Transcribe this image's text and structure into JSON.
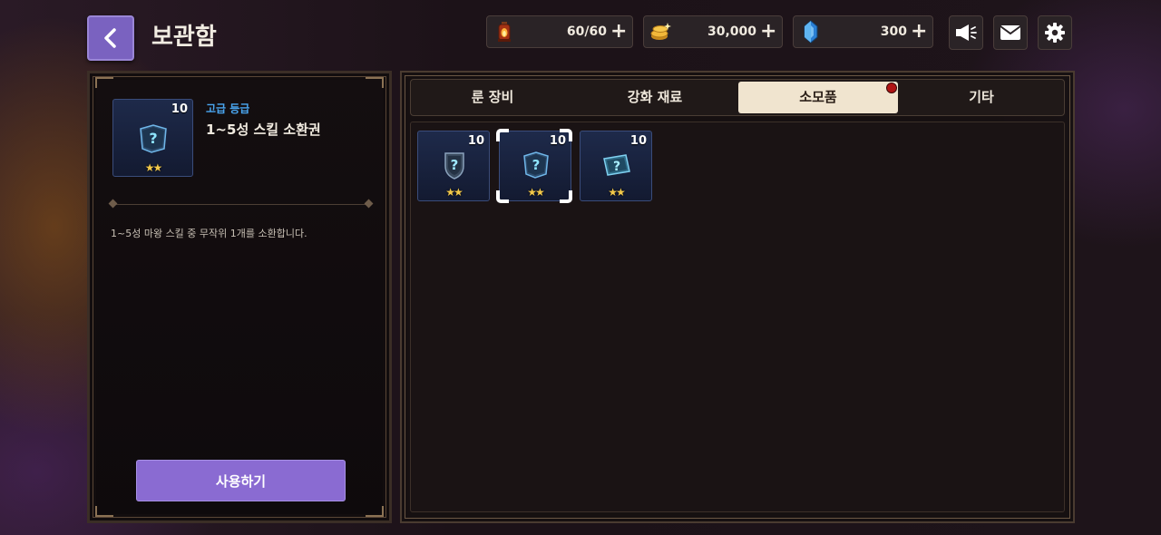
{
  "header": {
    "title": "보관함",
    "resources": [
      {
        "name": "energy",
        "icon": "lantern-icon",
        "value": "60/60"
      },
      {
        "name": "gold",
        "icon": "gold-coins-icon",
        "value": "30,000"
      },
      {
        "name": "gem",
        "icon": "blue-crystal-icon",
        "value": "300"
      }
    ],
    "plus_label": "+"
  },
  "detail": {
    "count": "10",
    "stars": "★★",
    "grade": "고급 등급",
    "name": "1~5성 스킬 소환권",
    "description": "1~5성 마왕 스킬 중 무작위 1개를 소환합니다.",
    "use_button": "사용하기"
  },
  "tabs": [
    {
      "label": "룬 장비",
      "active": false
    },
    {
      "label": "강화 재료",
      "active": false
    },
    {
      "label": "소모품",
      "active": true,
      "notification": true
    },
    {
      "label": "기타",
      "active": false
    }
  ],
  "items": [
    {
      "count": "10",
      "stars": "★★",
      "icon": "mystery-shield-icon",
      "selected": false
    },
    {
      "count": "10",
      "stars": "★★",
      "icon": "mystery-book-icon",
      "selected": true
    },
    {
      "count": "10",
      "stars": "★★",
      "icon": "mystery-scroll-icon",
      "selected": false
    }
  ],
  "colors": {
    "accent_purple": "#8a6bd2",
    "grade_blue": "#4aa6f0",
    "star_gold": "#f3c94a",
    "active_tab": "#f0e4cf",
    "notification_red": "#b01414"
  }
}
